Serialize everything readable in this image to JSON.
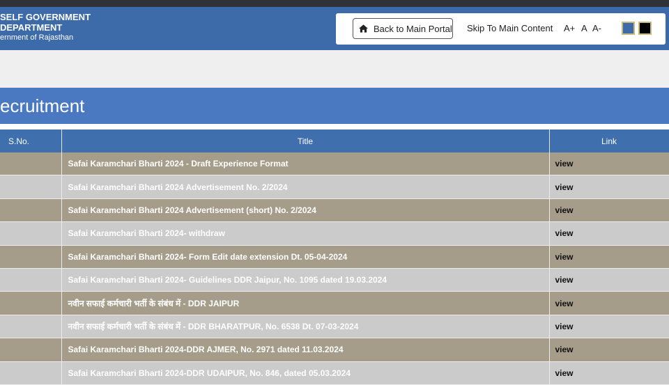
{
  "header": {
    "org_line1": "SELF GOVERNMENT",
    "org_line2": "DEPARTMENT",
    "org_line3": "ernment of Rajasthan",
    "back_button": "Back to Main Portal",
    "skip_link": "Skip To Main Content",
    "font_increase": "A+",
    "font_normal": "A",
    "font_decrease": "A-",
    "theme_colors": {
      "blue": "#3d6aa8",
      "black": "#000000"
    }
  },
  "page": {
    "title": "ecruitment"
  },
  "table": {
    "headers": [
      "S.No.",
      "Title",
      "Link"
    ],
    "rows": [
      {
        "title": "Safai Karamchari Bharti 2024 - Draft Experience Format",
        "link": "view"
      },
      {
        "title": "Safai Karamchari Bharti 2024 Advertisement No.  2/2024",
        "link": "view"
      },
      {
        "title": "Safai Karamchari Bharti 2024 Advertisement (short)  No. 2/2024",
        "link": "view"
      },
      {
        "title": "Safai Karamchari Bharti 2024- withdraw",
        "link": "view"
      },
      {
        "title": "Safai Karamchari Bharti 2024- Form Edit date extension Dt. 05-04-2024",
        "link": "view"
      },
      {
        "title": "Safai Karamchari Bharti 2024- Guidelines DDR Jaipur, No. 1095 dated 19.03.2024",
        "link": "view"
      },
      {
        "title": "नवीन सफाई कर्मचारी भर्ती के संबंध में - DDR JAIPUR",
        "link": "view"
      },
      {
        "title": "नवीन सफाई कर्मचारी भर्ती के संबंध में - DDR BHARATPUR, No. 6538 Dt. 07-03-2024",
        "link": "view"
      },
      {
        "title": "Safai Karamchari Bharti 2024-DDR AJMER, No. 2971 dated 11.03.2024",
        "link": "view"
      },
      {
        "title": "Safai Karamchari Bharti 2024-DDR UDAIPUR, No. 846, dated 05.03.2024",
        "link": "view"
      }
    ]
  }
}
